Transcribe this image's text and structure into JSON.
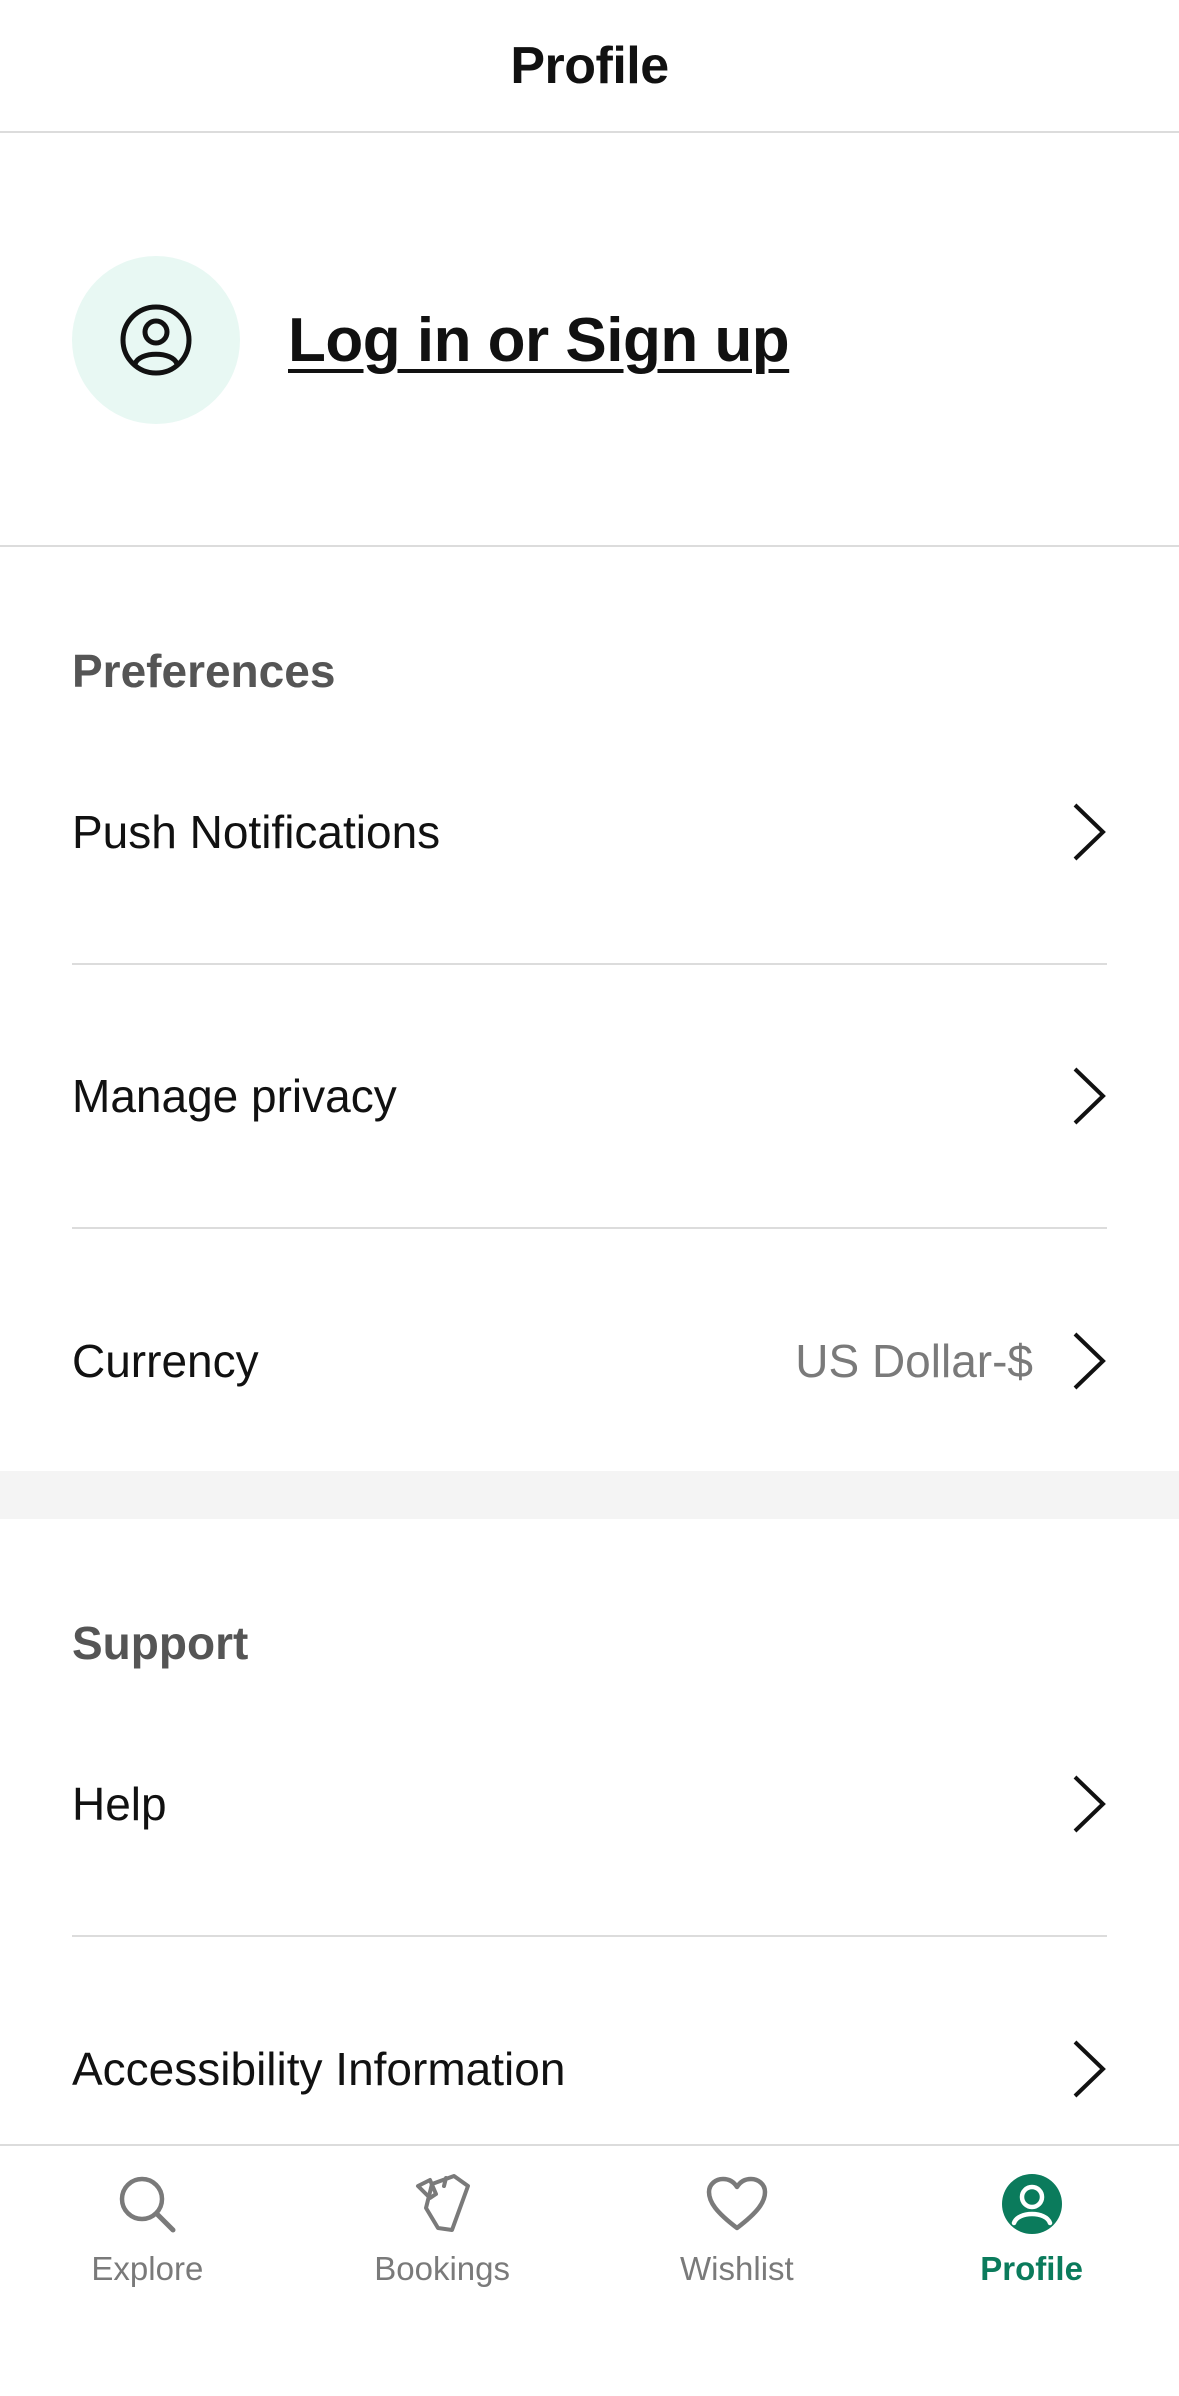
{
  "header": {
    "title": "Profile"
  },
  "login": {
    "link_label": "Log in or Sign up"
  },
  "preferences": {
    "title": "Preferences",
    "items": [
      {
        "label": "Push Notifications"
      },
      {
        "label": "Manage privacy"
      },
      {
        "label": "Currency",
        "value": "US Dollar-$"
      }
    ]
  },
  "support": {
    "title": "Support",
    "items": [
      {
        "label": "Help"
      },
      {
        "label": "Accessibility Information"
      }
    ]
  },
  "tabbar": {
    "tabs": [
      {
        "label": "Explore",
        "icon": "search-icon"
      },
      {
        "label": "Bookings",
        "icon": "tickets-icon"
      },
      {
        "label": "Wishlist",
        "icon": "heart-icon"
      },
      {
        "label": "Profile",
        "icon": "profile-icon",
        "active": true
      }
    ]
  },
  "colors": {
    "accent": "#0b7b5c",
    "avatar_bg": "#e8f8f3",
    "muted_text": "#7a7a7a"
  }
}
